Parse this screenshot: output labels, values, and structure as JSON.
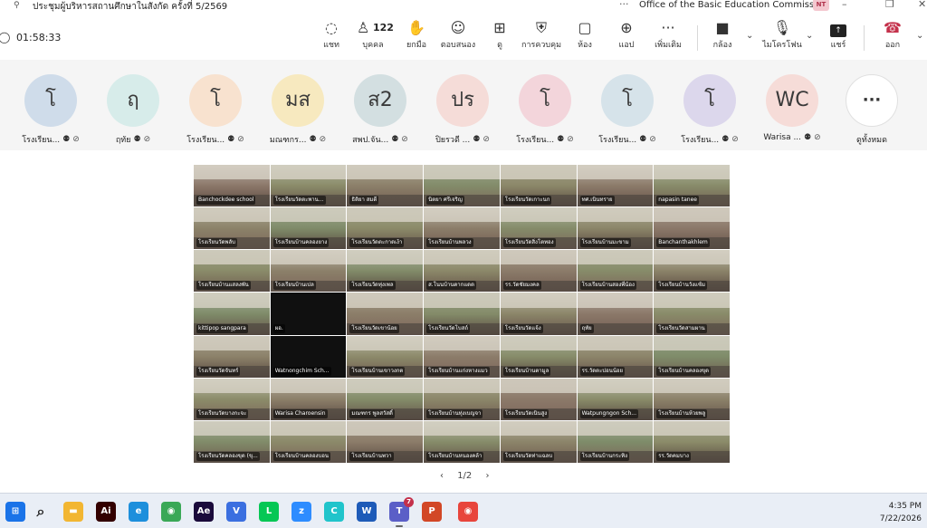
{
  "window": {
    "title": "ประชุมผู้บริหารสถานศึกษาในสังกัด ครั้งที่ 5/2569",
    "more": "···",
    "org": "Office of the Basic Education Commission",
    "user_initials": "NT"
  },
  "toolbar": {
    "timer": "01:58:33",
    "participant_count": "122",
    "buttons": {
      "chat": "แชท",
      "people": "บุคคล",
      "raise": "ยกมือ",
      "react": "ตอบสนอง",
      "view": "ดู",
      "controls": "การควบคุม",
      "rooms": "ห้อง",
      "apps": "แอป",
      "more": "เพิ่มเติม",
      "camera": "กล้อง",
      "mic": "ไมโครโฟน",
      "share": "แชร์",
      "leave": "ออก"
    }
  },
  "participants": [
    {
      "initials": "โ",
      "name": "โรงเรียน...",
      "color": "#cfdcea"
    },
    {
      "initials": "ฤ",
      "name": "ฤทัย",
      "color": "#d7ecea"
    },
    {
      "initials": "โ",
      "name": "โรงเรียน...",
      "color": "#f8e2cf"
    },
    {
      "initials": "มส",
      "name": "มณฑกร...",
      "color": "#f7e9bf"
    },
    {
      "initials": "ส2",
      "name": "สพป.จัน...",
      "color": "#d3dfe1"
    },
    {
      "initials": "ปร",
      "name": "ปิยรวดี ...",
      "color": "#f5dcd8"
    },
    {
      "initials": "โ",
      "name": "โรงเรียน...",
      "color": "#f3d5db"
    },
    {
      "initials": "โ",
      "name": "โรงเรียน...",
      "color": "#d6e3ea"
    },
    {
      "initials": "โ",
      "name": "โรงเรียน...",
      "color": "#dcd7ec"
    },
    {
      "initials": "WC",
      "name": "Warisa ...",
      "color": "#f6dcd8"
    }
  ],
  "see_all": {
    "icon": "···",
    "label": "ดูทั้งหมด"
  },
  "gallery_names": [
    "Banchockdee school",
    "โรงเรียนวัดตะพาน...",
    "ธิติยา สมดี",
    "นิตยา ศรีเจริญ",
    "โรงเรียนวัดเกาะนก",
    "ทศ.เนินทราย",
    "napasin tanee",
    "โรงเรียนวัดพลับ",
    "โรงเรียนบ้านคลองยาง",
    "โรงเรียนวัดตะกาดเง้า",
    "โรงเรียนบ้านพลวง",
    "โรงเรียนวัดสิ่งโตทอง",
    "โรงเรียนบ้านมะขาม",
    "Banchanthakhlem",
    "โรงเรียนบ้านแสลงพัน",
    "โรงเรียนบ้านเปล",
    "โรงเรียนวัดทุ่งเพล",
    "ส.โนนบ้านตากแดด",
    "รร.วัดชัยมงคล",
    "โรงเรียนบ้านสองพี่น้อง",
    "โรงเรียนบ้านวังแซ้ม",
    "kittipop sangpara",
    "ผอ.",
    "โรงเรียนวัดเขาน้อย",
    "โรงเรียนวัดโบสถ์",
    "โรงเรียนวัดแจ้ง",
    "ฤทัย",
    "โรงเรียนวัดสามผาน",
    "โรงเรียนวัดจันทร์",
    "Watnongchim Sch...",
    "โรงเรียนบ้านเขาวงกต",
    "โรงเรียนบ้านแก่งหางแมว",
    "โรงเรียนบ้านตามูล",
    "รร.วัดตะปอนน้อย",
    "โรงเรียนบ้านคลองขุด",
    "โรงเรียนวัดบางกะจะ",
    "Warisa Charoensin",
    "มณฑกร พูลสวัสดิ์",
    "โรงเรียนบ้านทุ่งเบญจา",
    "โรงเรียนวัดเนินสูง",
    "Watpungngon Sch...",
    "โรงเรียนบ้านห้วยพลู",
    "โรงเรียนวัดคลองขุด (ขุ...",
    "โรงเรียนบ้านคลองบอน",
    "โรงเรียนบ้านพวา",
    "โรงเรียนบ้านหนองคล้า",
    "โรงเรียนวัดท่าแฉลบ",
    "โรงเรียนบ้านกระทิง",
    "รร.วัดคมบาง"
  ],
  "pager": {
    "prev": "‹",
    "label": "1/2",
    "next": "›"
  },
  "taskbar": {
    "teams_badge": "7",
    "time": "4:35 PM",
    "date": "7/22/2026",
    "apps": [
      {
        "name": "start",
        "icon": "⊞",
        "color": "#1a73e8"
      },
      {
        "name": "search",
        "icon": "⌕",
        "color": "#222222"
      },
      {
        "name": "file-explorer",
        "icon": "▬",
        "color": "#f2b632"
      },
      {
        "name": "illustrator",
        "icon": "Ai",
        "color": "#330000"
      },
      {
        "name": "edge",
        "icon": "e",
        "color": "#1d8fdc"
      },
      {
        "name": "chrome",
        "icon": "◉",
        "color": "#3aa857"
      },
      {
        "name": "after-effects",
        "icon": "Ae",
        "color": "#1a0a3b"
      },
      {
        "name": "v-app",
        "icon": "V",
        "color": "#3b6fe0"
      },
      {
        "name": "line",
        "icon": "L",
        "color": "#06c755"
      },
      {
        "name": "zoom",
        "icon": "z",
        "color": "#2d8cff"
      },
      {
        "name": "canva",
        "icon": "C",
        "color": "#20c4cb"
      },
      {
        "name": "word",
        "icon": "W",
        "color": "#1e5bb8"
      },
      {
        "name": "teams",
        "icon": "T",
        "color": "#5b5fc7"
      },
      {
        "name": "powerpoint",
        "icon": "P",
        "color": "#d24726"
      },
      {
        "name": "chrome-profile",
        "icon": "◉",
        "color": "#e8453c"
      }
    ]
  }
}
